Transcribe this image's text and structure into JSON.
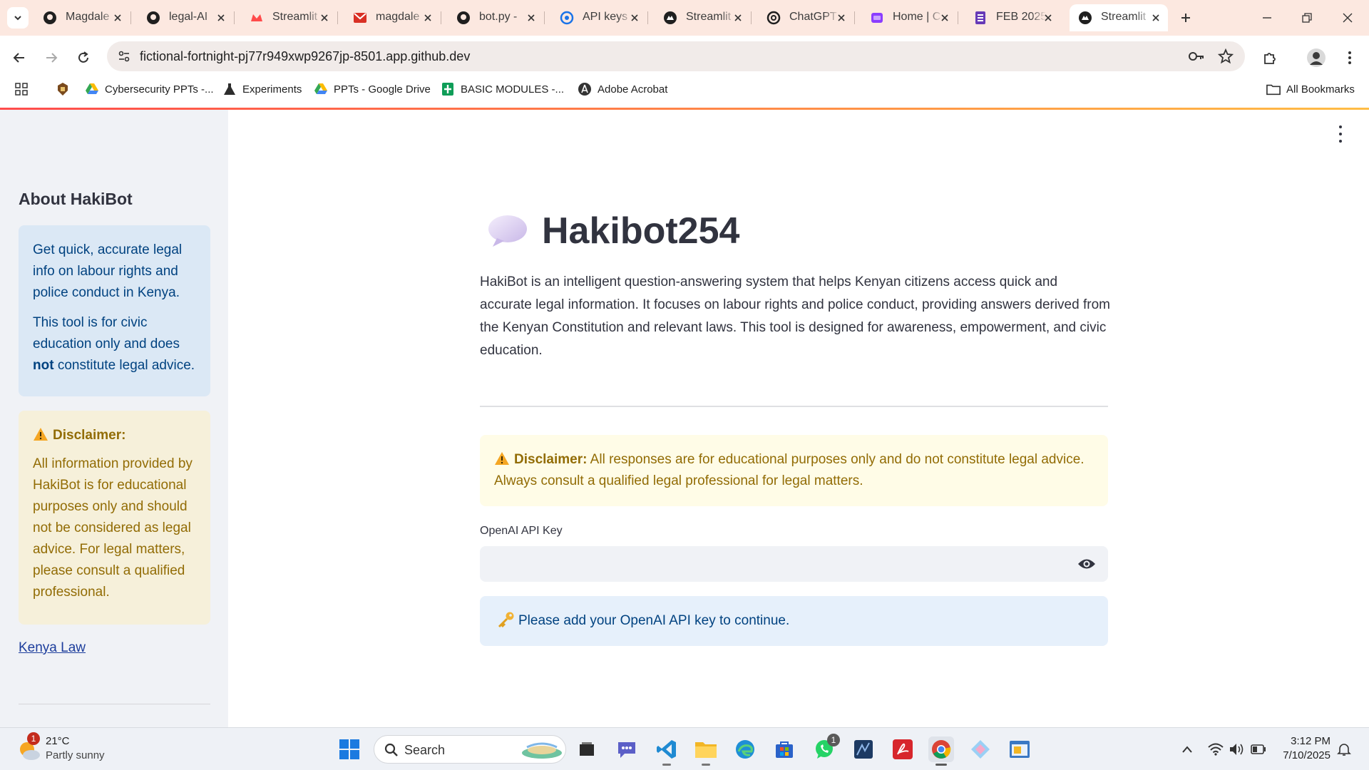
{
  "browser": {
    "tabs": [
      {
        "title": "Magdale",
        "icon": "github-icon"
      },
      {
        "title": "legal-AI",
        "icon": "github-icon"
      },
      {
        "title": "Streamlit",
        "icon": "streamlit-icon"
      },
      {
        "title": "magdale",
        "icon": "gmail-icon"
      },
      {
        "title": "bot.py -",
        "icon": "github-icon"
      },
      {
        "title": "API keys",
        "icon": "openai-platform-icon"
      },
      {
        "title": "Streamlit",
        "icon": "streamlit-icon"
      },
      {
        "title": "ChatGPT",
        "icon": "chatgpt-icon"
      },
      {
        "title": "Home | C",
        "icon": "canva-icon"
      },
      {
        "title": "FEB 2025",
        "icon": "forms-icon"
      },
      {
        "title": "Streamlit",
        "icon": "streamlit-icon"
      }
    ],
    "url": "fictional-fortnight-pj77r949xwp9267jp-8501.app.github.dev",
    "bookmarks": [
      {
        "label": "",
        "icon": "apps-grid-icon"
      },
      {
        "label": "",
        "icon": "emblem-icon"
      },
      {
        "label": "Cybersecurity PPTs -...",
        "icon": "google-drive-icon"
      },
      {
        "label": "Experiments",
        "icon": "flask-icon"
      },
      {
        "label": "PPTs - Google Drive",
        "icon": "google-drive-icon"
      },
      {
        "label": "BASIC MODULES -...",
        "icon": "sheets-icon"
      },
      {
        "label": "Adobe Acrobat",
        "icon": "acrobat-icon"
      }
    ],
    "all_bookmarks": "All Bookmarks"
  },
  "sidebar": {
    "heading": "About HakiBot",
    "info_p1": "Get quick, accurate legal info on labour rights and police conduct in Kenya.",
    "info_p2_a": "This tool is for civic education only and does ",
    "info_p2_b": "not",
    "info_p2_c": " constitute legal advice.",
    "disclaimer_title": "Disclaimer:",
    "disclaimer_body": "All information provided by HakiBot is for educational purposes only and should not be considered as legal advice. For legal matters, please consult a qualified professional.",
    "link": "Kenya Law"
  },
  "main": {
    "title": "Hakibot254",
    "intro": "HakiBot is an intelligent question-answering system that helps Kenyan citizens access quick and accurate legal information. It focuses on labour rights and police conduct, providing answers derived from the Kenyan Constitution and relevant laws. This tool is designed for awareness, empowerment, and civic education.",
    "disclaimer_title": "Disclaimer:",
    "disclaimer_body": " All responses are for educational purposes only and do not constitute legal advice. Always consult a qualified legal professional for legal matters.",
    "api_label": "OpenAI API Key",
    "api_value": "",
    "info_message": "Please add your OpenAI API key to continue."
  },
  "taskbar": {
    "weather_temp": "21°C",
    "weather_desc": "Partly sunny",
    "weather_badge": "1",
    "search_placeholder": "Search",
    "whatsapp_badge": "1",
    "time": "3:12 PM",
    "date": "7/10/2025"
  },
  "colors": {
    "accent_gradient_start": "#ff4b4b",
    "accent_gradient_end": "#ffbd45",
    "info_bg": "#dbe8f5",
    "warning_bg": "#f6f0da",
    "sidebar_bg": "#f0f2f6"
  }
}
